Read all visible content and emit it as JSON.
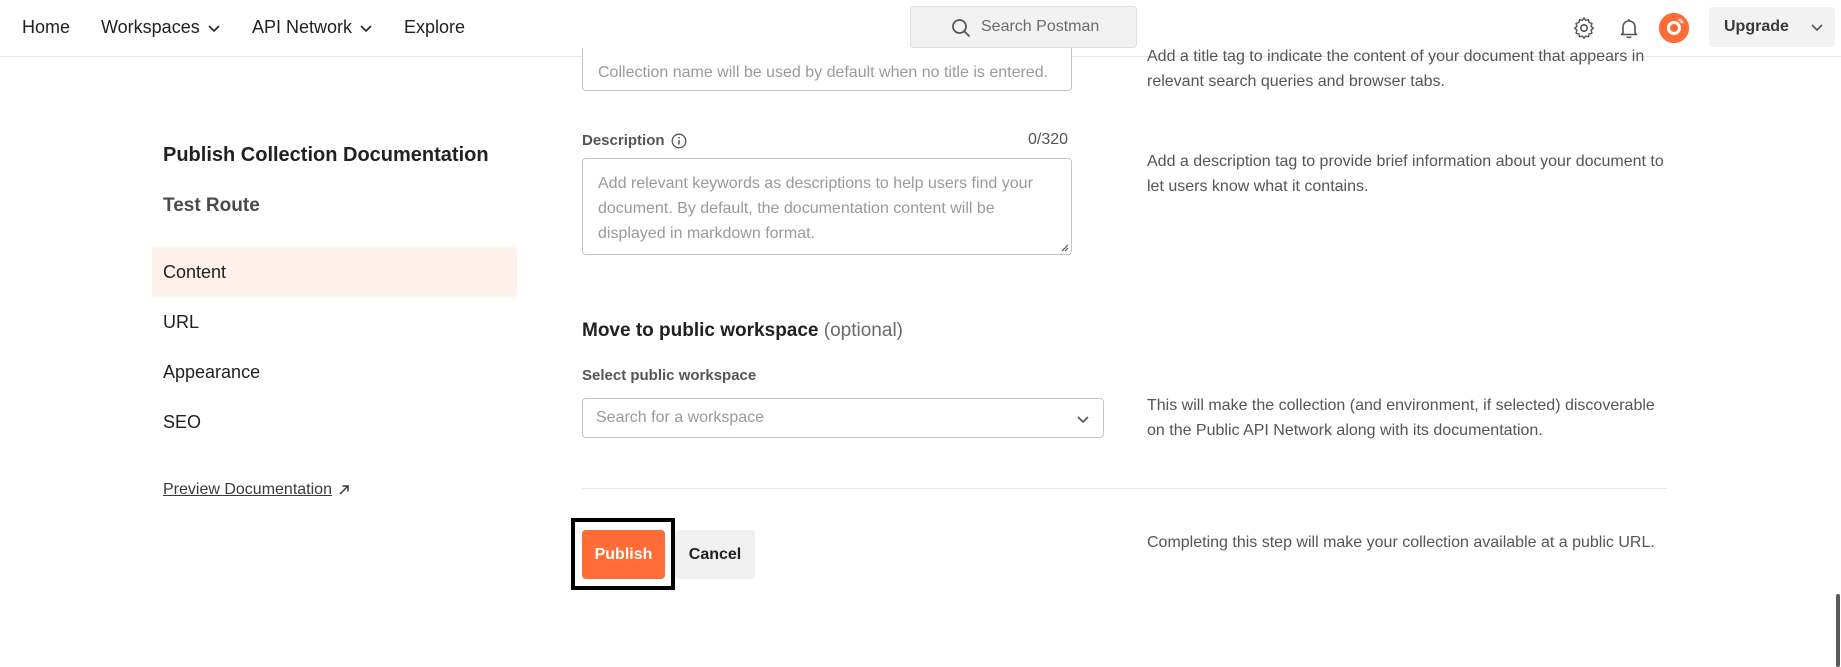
{
  "nav": {
    "home": "Home",
    "workspaces": "Workspaces",
    "api_network": "API Network",
    "explore": "Explore",
    "search_placeholder": "Search Postman",
    "upgrade": "Upgrade"
  },
  "icons": {
    "search": "search-icon",
    "settings": "gear-icon",
    "notifications": "bell-icon",
    "avatar": "avatar",
    "chevron": "chevron-down-icon",
    "info": "info-icon",
    "external": "external-link-icon"
  },
  "colors": {
    "accent": "#ff6c37",
    "active_bg": "#fff1eb"
  },
  "sidebar": {
    "title": "Publish Collection Documentation",
    "collection_name": "Test Route",
    "items": [
      {
        "label": "Content",
        "active": true
      },
      {
        "label": "URL",
        "active": false
      },
      {
        "label": "Appearance",
        "active": false
      },
      {
        "label": "SEO",
        "active": false
      }
    ],
    "preview_link": "Preview Documentation"
  },
  "form": {
    "title_placeholder": "Collection name will be used by default when no title is entered.",
    "title_help": "Add a title tag to indicate the content of your document that appears in relevant search queries and browser tabs.",
    "description_label": "Description",
    "description_counter": "0/320",
    "description_placeholder": "Add relevant keywords as descriptions to help users find your document. By default, the documentation content will be displayed in markdown format.",
    "description_help": "Add a description tag to provide brief information about your document to let users know what it contains.",
    "workspace_section_title": "Move to public workspace",
    "workspace_section_optional": "(optional)",
    "workspace_label": "Select public workspace",
    "workspace_placeholder": "Search for a workspace",
    "workspace_help": "This will make the collection (and environment, if selected) discoverable on the Public API Network along with its documentation.",
    "publish_label": "Publish",
    "cancel_label": "Cancel",
    "publish_help": "Completing this step will make your collection available at a public URL."
  }
}
